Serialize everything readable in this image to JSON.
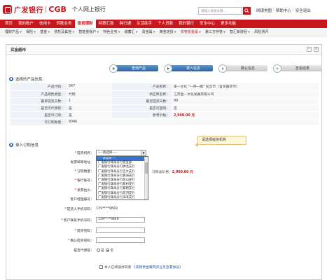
{
  "header": {
    "bank_name": "广发银行",
    "bank_en": "CGB",
    "subtitle": "个人网上银行",
    "search_placeholder": "请输入搜索关键...",
    "links": [
      "网银地图",
      "帮助中心",
      "安全退出"
    ]
  },
  "main_nav": [
    {
      "label": "首页",
      "active": false
    },
    {
      "label": "我的账户",
      "active": false
    },
    {
      "label": "信用卡",
      "active": false
    },
    {
      "label": "转账业务",
      "active": false
    },
    {
      "label": "投资理财",
      "active": true
    },
    {
      "label": "特惠汇款",
      "active": false
    },
    {
      "label": "跨行通",
      "active": false
    },
    {
      "label": "生活助手",
      "active": false
    },
    {
      "label": "个人贷款",
      "active": false
    },
    {
      "label": "我的银行",
      "active": false
    },
    {
      "label": "安全中心",
      "active": false
    },
    {
      "label": "更多功能",
      "active": false
    }
  ],
  "sub_nav": [
    {
      "label": "理财产品",
      "active": false
    },
    {
      "label": "保险",
      "active": false
    },
    {
      "label": "基金",
      "active": false
    },
    {
      "label": "债托及其他",
      "active": false
    },
    {
      "label": "智能金账户",
      "active": false
    },
    {
      "label": "特色业务",
      "active": false
    },
    {
      "label": "储蓄汇",
      "active": false
    },
    {
      "label": "贵金属",
      "active": false
    },
    {
      "label": "黄金定投",
      "active": false
    },
    {
      "label": "实物贵金属",
      "active": true
    },
    {
      "label": "第三方存管",
      "active": false
    },
    {
      "label": "智汇新财经",
      "active": false
    },
    {
      "label": "风险测评",
      "active": false
    }
  ],
  "frame": {
    "title": "买金超市"
  },
  "steps": [
    {
      "label": "查询产品",
      "state": "done"
    },
    {
      "label": "录入信息",
      "state": "done"
    },
    {
      "label": "确认信息",
      "state": "todo"
    },
    {
      "label": "查看结果",
      "state": "todo"
    }
  ],
  "section1": {
    "title": "选择的产品信息"
  },
  "product_rows": [
    {
      "l1": "产品代码：",
      "v1": "347",
      "l2": "产品名称：",
      "v2": "金一文化 \"一带一路\" 纪念币（含多国货币）",
      "red2": false
    },
    {
      "l1": "产品销售类型：",
      "v1": "代销",
      "l2": "供应商名称：",
      "v2": "江苏金一文化发展有限公司",
      "red2": false
    },
    {
      "l1": "最早提货天数：",
      "v1": "1",
      "l2": "最迟提货天数：",
      "v2": "99",
      "red2": false
    },
    {
      "l1": "是否可代保管：",
      "v1": "是",
      "l2": "是否可回购：",
      "v2": "否",
      "red2": false
    },
    {
      "l1": "是否可订购：",
      "v1": "是",
      "l2": "参考价格：",
      "v2": "2,900.00 元",
      "red2": true
    },
    {
      "l1": "可订购数量：",
      "v1": "9046",
      "l2": "",
      "v2": "",
      "red2": false
    }
  ],
  "section2": {
    "title": "录入订购信息"
  },
  "tooltip": "请选择提货机构",
  "form": {
    "pickup_org_label": "提货机构：",
    "pickup_org_value": "----请选择----",
    "invoice_addr_label": "发票邮寄地址：",
    "quantity_label": "订购数量：",
    "total_price_label": "订购总价格：",
    "total_price_value": "2,900.00 元",
    "bank_account_label": "银行账号：",
    "invoice_title_label": "发票抬头：",
    "cust_manager_label": "客户经理编号：",
    "pickup_phone_label": "提货人手机号码：",
    "pickup_phone_value": "139****9849",
    "customer_phone_label": "客户联系手机号码：",
    "customer_phone_value": "139****9849",
    "pickup_pwd_label": "提货密码：",
    "confirm_pwd_label": "确认提货密码：",
    "custody_label": "是否代保管：",
    "custody_yes": "是",
    "custody_no": "否",
    "agree_text": "本人已阅读并同意",
    "agree_link": "《实物贵金属购买业务签署协议》"
  },
  "dropdown_options": [
    "----请选择----",
    "广发银行珠海分行营业部",
    "广发银行珠海分行拱北支行",
    "广发银行珠海分行吉大支行",
    "广发银行珠海分行香洲支行",
    "广发银行珠海分行前山支行",
    "广发银行珠海分行新村支行",
    "广发银行珠海分行紫荆支行",
    "广发银行珠海分行前河支行",
    "广发银行珠海分行海滨支行",
    "广发银行珠海分行夏湾支行"
  ],
  "colors": {
    "brand_red": "#c8161d",
    "step_blue": "#2a64a8",
    "select_blue": "#3874c6"
  }
}
